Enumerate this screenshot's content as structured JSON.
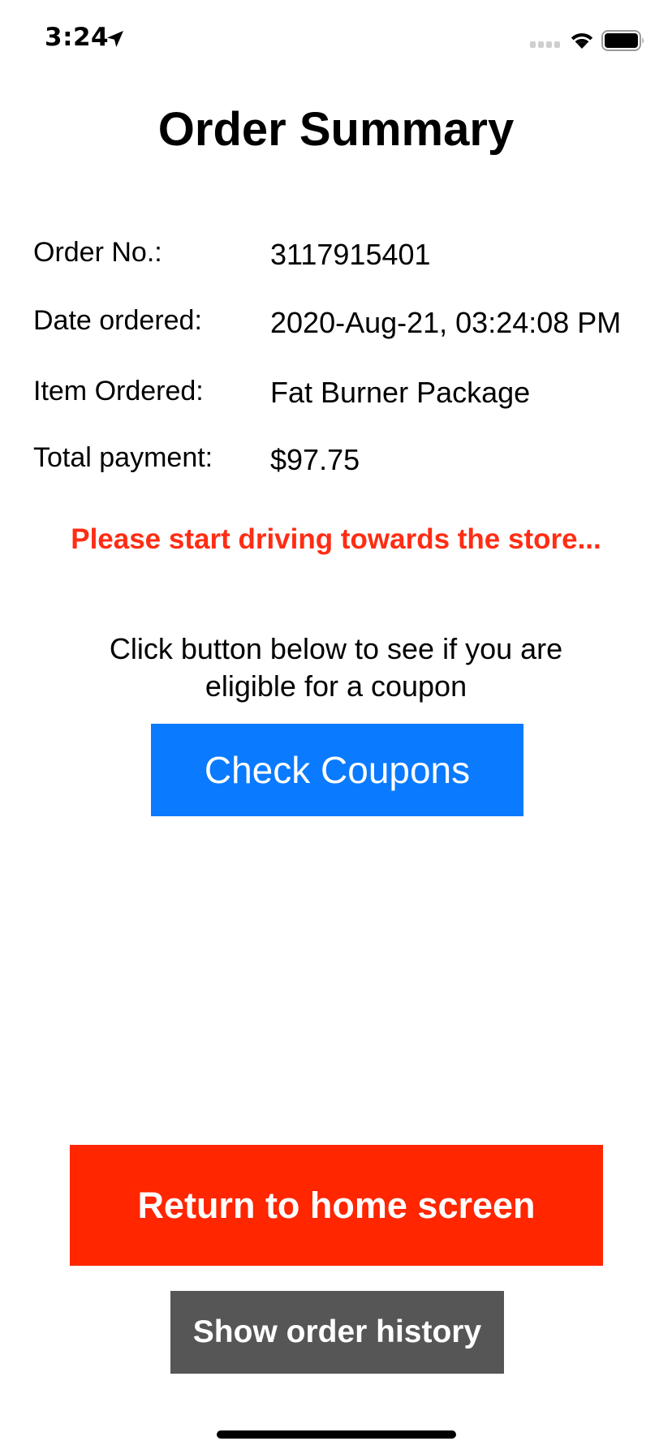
{
  "status_bar": {
    "time": "3:24",
    "icons": [
      "location-arrow-icon",
      "cellular-signal-icon",
      "wifi-icon",
      "battery-icon"
    ]
  },
  "title": "Order Summary",
  "details": {
    "order_no": {
      "label": "Order No.:",
      "value": "3117915401"
    },
    "date_ordered": {
      "label": "Date ordered:",
      "value": "2020-Aug-21, 03:24:08 PM"
    },
    "item_ordered": {
      "label": "Item Ordered:",
      "value": "Fat Burner Package"
    },
    "total_payment": {
      "label": "Total payment:",
      "value": "$97.75"
    }
  },
  "notice": "Please start driving towards the store...",
  "coupon_prompt": "Click button below to see if you are eligible for a coupon",
  "buttons": {
    "check_coupons": "Check Coupons",
    "return_home": "Return to home screen",
    "order_history": "Show order history"
  },
  "colors": {
    "notice_red": "#ff2d14",
    "check_coupons_blue": "#0a7afe",
    "return_home_red": "#ff2600",
    "order_history_gray": "#565656"
  }
}
